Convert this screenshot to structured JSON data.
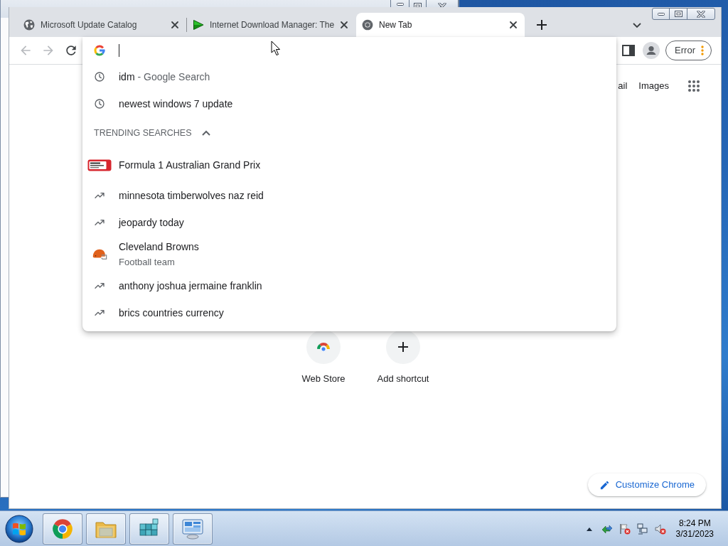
{
  "tabs": [
    {
      "kind": "globe",
      "title": "Microsoft Update Catalog",
      "selected": false
    },
    {
      "kind": "play",
      "title": "Internet Download Manager: The",
      "selected": false
    },
    {
      "kind": "chrome",
      "title": "New Tab",
      "selected": true
    }
  ],
  "toolbar": {
    "back": {
      "disabled": true
    },
    "forward": {
      "disabled": true
    },
    "profile_label": "Error"
  },
  "omnibox": {
    "suggestions": [
      {
        "kind": "history",
        "text": "idm",
        "suffix": "- Google Search"
      },
      {
        "kind": "history",
        "text": "newest windows 7 update"
      }
    ],
    "trending": {
      "label": "TRENDING SEARCHES",
      "expanded": true,
      "items": [
        {
          "kind": "logo",
          "text": "Formula 1 Australian Grand Prix"
        },
        {
          "kind": "trend",
          "text": "minnesota timberwolves naz reid"
        },
        {
          "kind": "trend",
          "text": "jeopardy today"
        },
        {
          "kind": "helmet",
          "text": "Cleveland Browns",
          "subtitle": "Football team"
        },
        {
          "kind": "trend",
          "text": "anthony joshua jermaine franklin"
        },
        {
          "kind": "trend",
          "text": "brics countries currency"
        }
      ]
    }
  },
  "page": {
    "header_links": [
      "ail",
      "Images"
    ],
    "shortcuts": [
      {
        "kind": "webstore",
        "label": "Web Store"
      },
      {
        "kind": "add",
        "label": "Add shortcut"
      }
    ],
    "customize_button": "Customize Chrome"
  },
  "taskbar": {
    "apps": [
      {
        "kind": "chrome"
      },
      {
        "kind": "folder"
      },
      {
        "kind": "cubes"
      },
      {
        "kind": "panel"
      }
    ],
    "clock": {
      "time": "8:24 PM",
      "date": "3/31/2023"
    }
  }
}
